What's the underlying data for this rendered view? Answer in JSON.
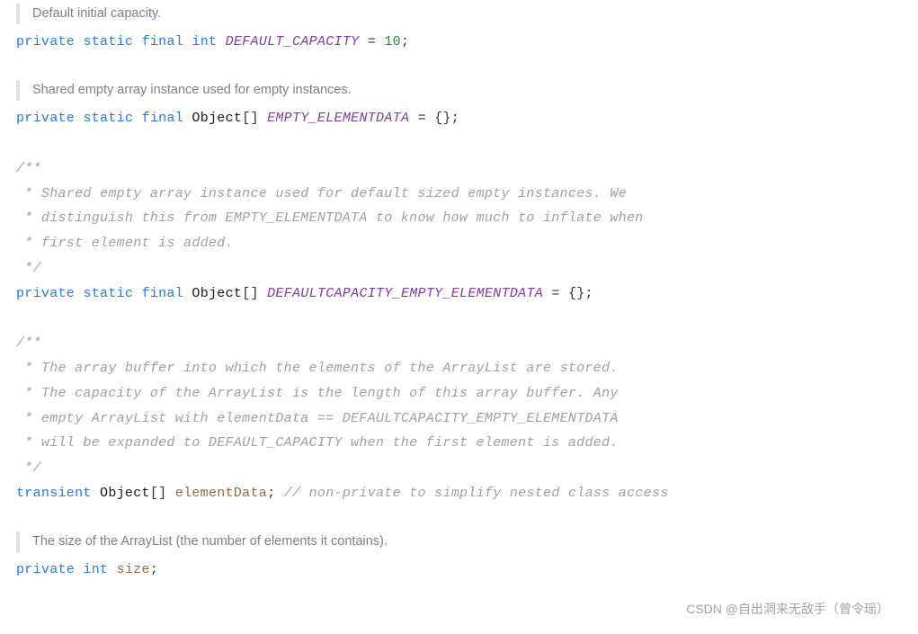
{
  "blocks": [
    {
      "type": "doc",
      "text": "Default initial capacity."
    },
    {
      "type": "code",
      "spans": [
        {
          "cls": "kw",
          "t": "private"
        },
        {
          "cls": "",
          "t": " "
        },
        {
          "cls": "kw",
          "t": "static"
        },
        {
          "cls": "",
          "t": " "
        },
        {
          "cls": "kw",
          "t": "final"
        },
        {
          "cls": "",
          "t": " "
        },
        {
          "cls": "type",
          "t": "int"
        },
        {
          "cls": "",
          "t": " "
        },
        {
          "cls": "const-purple",
          "t": "DEFAULT_CAPACITY"
        },
        {
          "cls": "",
          "t": " "
        },
        {
          "cls": "punc",
          "t": "="
        },
        {
          "cls": "",
          "t": " "
        },
        {
          "cls": "num",
          "t": "10"
        },
        {
          "cls": "punc",
          "t": ";"
        }
      ]
    },
    {
      "type": "doc",
      "text": "Shared empty array instance used for empty instances."
    },
    {
      "type": "code",
      "spans": [
        {
          "cls": "kw",
          "t": "private"
        },
        {
          "cls": "",
          "t": " "
        },
        {
          "cls": "kw",
          "t": "static"
        },
        {
          "cls": "",
          "t": " "
        },
        {
          "cls": "kw",
          "t": "final"
        },
        {
          "cls": "",
          "t": " "
        },
        {
          "cls": "cls",
          "t": "Object"
        },
        {
          "cls": "punc",
          "t": "[]"
        },
        {
          "cls": "",
          "t": " "
        },
        {
          "cls": "const-purple",
          "t": "EMPTY_ELEMENTDATA"
        },
        {
          "cls": "",
          "t": " "
        },
        {
          "cls": "punc",
          "t": "= {};"
        }
      ]
    },
    {
      "type": "code",
      "spans": [
        {
          "cls": "cm",
          "t": "/**\n * Shared empty array instance used for default sized empty instances. We\n * distinguish this from EMPTY_ELEMENTDATA to know how much to inflate when\n * first element is added.\n */"
        },
        {
          "cls": "",
          "t": "\n"
        },
        {
          "cls": "kw",
          "t": "private"
        },
        {
          "cls": "",
          "t": " "
        },
        {
          "cls": "kw",
          "t": "static"
        },
        {
          "cls": "",
          "t": " "
        },
        {
          "cls": "kw",
          "t": "final"
        },
        {
          "cls": "",
          "t": " "
        },
        {
          "cls": "cls",
          "t": "Object"
        },
        {
          "cls": "punc",
          "t": "[]"
        },
        {
          "cls": "",
          "t": " "
        },
        {
          "cls": "const-purple",
          "t": "DEFAULTCAPACITY_EMPTY_ELEMENTDATA"
        },
        {
          "cls": "",
          "t": " "
        },
        {
          "cls": "punc",
          "t": "= {};"
        }
      ]
    },
    {
      "type": "code",
      "spans": [
        {
          "cls": "cm",
          "t": "/**\n * The array buffer into which the elements of the ArrayList are stored.\n * The capacity of the ArrayList is the length of this array buffer. Any\n * empty ArrayList with elementData == DEFAULTCAPACITY_EMPTY_ELEMENTDATA\n * will be expanded to DEFAULT_CAPACITY when the first element is added.\n */"
        },
        {
          "cls": "",
          "t": "\n"
        },
        {
          "cls": "kw",
          "t": "transient"
        },
        {
          "cls": "",
          "t": " "
        },
        {
          "cls": "cls",
          "t": "Object"
        },
        {
          "cls": "punc",
          "t": "[]"
        },
        {
          "cls": "",
          "t": " "
        },
        {
          "cls": "ident-brown",
          "t": "elementData"
        },
        {
          "cls": "punc",
          "t": ";"
        },
        {
          "cls": "",
          "t": " "
        },
        {
          "cls": "cm",
          "t": "// non-private to simplify nested class access"
        }
      ]
    },
    {
      "type": "doc",
      "text": "The size of the ArrayList (the number of elements it contains)."
    },
    {
      "type": "code",
      "last": true,
      "spans": [
        {
          "cls": "kw",
          "t": "private"
        },
        {
          "cls": "",
          "t": " "
        },
        {
          "cls": "type",
          "t": "int"
        },
        {
          "cls": "",
          "t": " "
        },
        {
          "cls": "ident-brown",
          "t": "size"
        },
        {
          "cls": "punc",
          "t": ";"
        }
      ]
    }
  ],
  "watermark": "CSDN @自出洞来无敌手（曾令瑶）"
}
